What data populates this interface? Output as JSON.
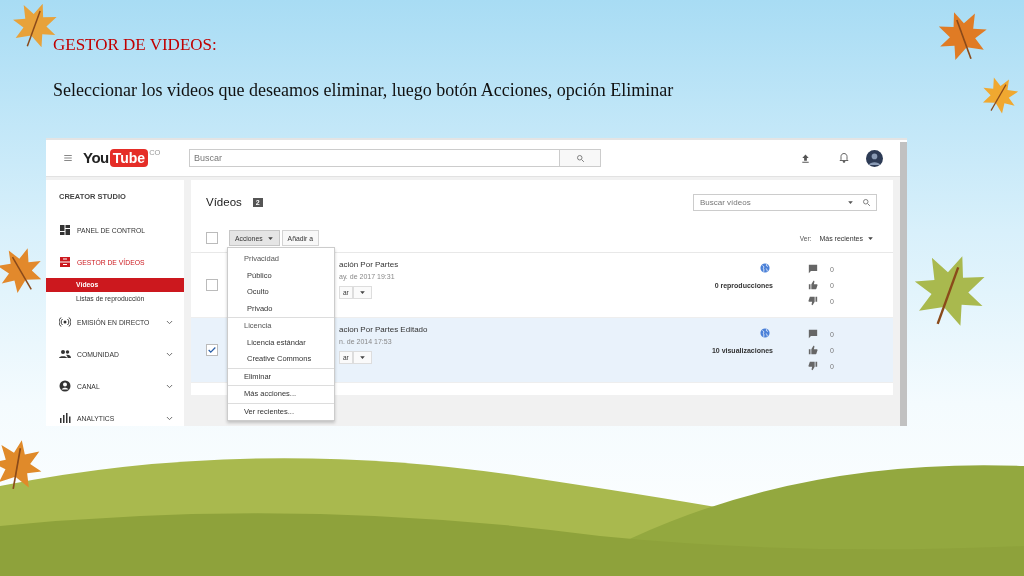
{
  "slide": {
    "title": "GESTOR DE VIDEOS:",
    "instruction": "Seleccionar los videos que deseamos eliminar, luego botón Acciones, opción Eliminar"
  },
  "topbar": {
    "logo": {
      "left": "You",
      "right": "Tube",
      "region": "CO"
    },
    "search": {
      "placeholder": "Buscar"
    }
  },
  "sidebar": {
    "heading": "CREATOR STUDIO",
    "items": [
      {
        "label": "PANEL DE CONTROL",
        "kind": "dashboard",
        "selected": false,
        "expandable": false
      },
      {
        "label": "GESTOR DE VÍDEOS",
        "kind": "manager",
        "selected": true,
        "expandable": false,
        "children": [
          {
            "label": "Vídeos",
            "selected": true
          },
          {
            "label": "Listas de reproducción",
            "selected": false
          }
        ]
      },
      {
        "label": "EMISIÓN EN DIRECTO",
        "kind": "live",
        "selected": false,
        "expandable": true
      },
      {
        "label": "COMUNIDAD",
        "kind": "people",
        "selected": false,
        "expandable": true
      },
      {
        "label": "CANAL",
        "kind": "account",
        "selected": false,
        "expandable": true
      },
      {
        "label": "ANALYTICS",
        "kind": "bars",
        "selected": false,
        "expandable": true
      }
    ]
  },
  "content": {
    "title": "Vídeos",
    "count": "2",
    "search": {
      "placeholder": "Buscar vídeos"
    },
    "toolbar": {
      "select_all": {
        "checked": false
      },
      "actions_button": {
        "label": "Acciones",
        "expanded": true
      },
      "add_button": "Añadir a",
      "sort_label": "Ver:",
      "sort_value": "Más recientes"
    },
    "videos": [
      {
        "checked": false,
        "title": "ación Por Partes",
        "date": "ay. de 2017 19:31",
        "edit_button": "ar",
        "views": "0 reproducciones",
        "comments": "0",
        "likes": "0",
        "dislikes": "0"
      },
      {
        "checked": true,
        "title": "acion Por Partes Editado",
        "date": "n. de 2014 17:53",
        "edit_button": "ar",
        "views": "10 visualizaciones",
        "comments": "0",
        "likes": "0",
        "dislikes": "0"
      }
    ],
    "actions_menu": [
      {
        "kind": "header",
        "label": "Privacidad"
      },
      {
        "kind": "option",
        "label": "Público"
      },
      {
        "kind": "option",
        "label": "Oculto"
      },
      {
        "kind": "option",
        "label": "Privado"
      },
      {
        "kind": "header",
        "label": "Licencia"
      },
      {
        "kind": "option",
        "label": "Licencia estándar"
      },
      {
        "kind": "option",
        "label": "Creative Commons"
      },
      {
        "kind": "action",
        "label": "Eliminar"
      },
      {
        "kind": "action",
        "label": "Más acciones..."
      },
      {
        "kind": "action",
        "label": "Ver recientes..."
      }
    ]
  }
}
